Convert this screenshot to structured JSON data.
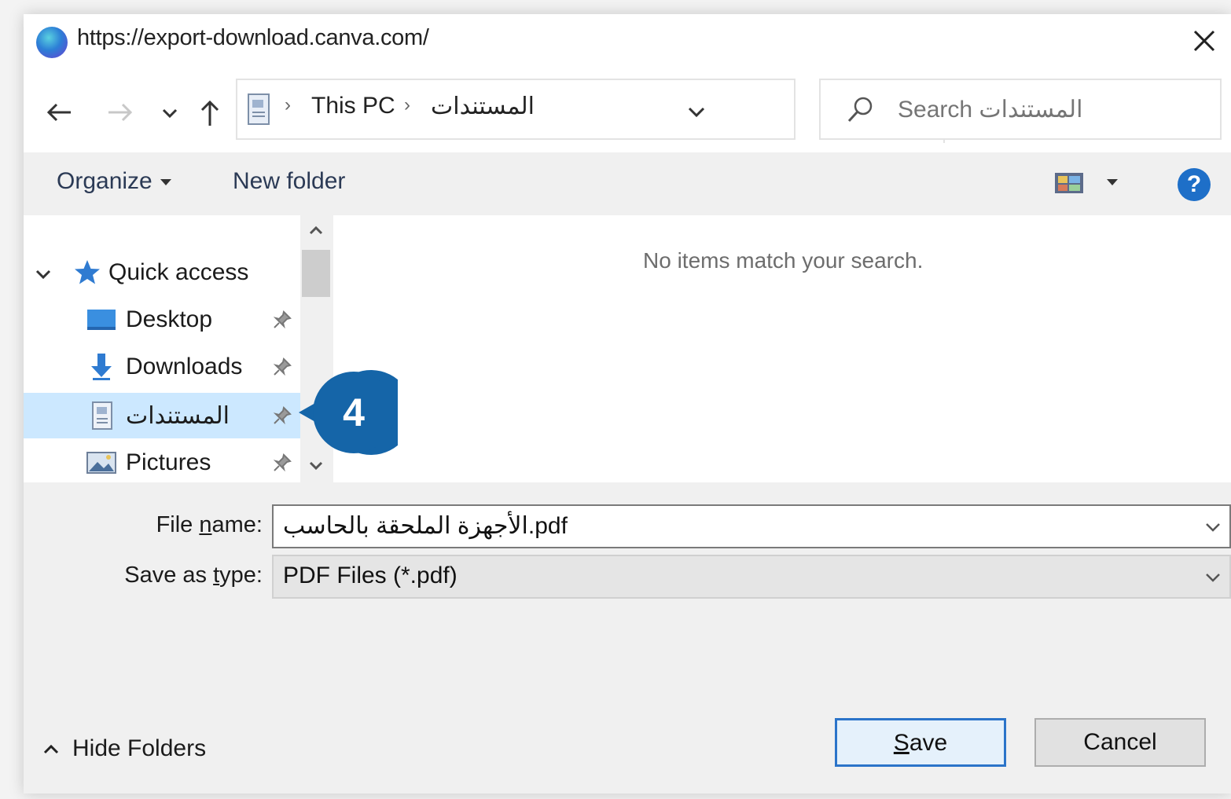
{
  "window": {
    "title": "https://export-download.canva.com/"
  },
  "nav": {
    "breadcrumb_root": "This PC",
    "breadcrumb_folder": "المستندات",
    "search_placeholder": "Search المستندات"
  },
  "toolbar": {
    "organize_label": "Organize",
    "new_folder_label": "New folder"
  },
  "sidebar": {
    "items": [
      {
        "label": "Quick access",
        "icon": "star-icon"
      },
      {
        "label": "Desktop",
        "icon": "desktop-icon"
      },
      {
        "label": "Downloads",
        "icon": "download-icon"
      },
      {
        "label": "المستندات",
        "icon": "document-icon",
        "selected": true
      },
      {
        "label": "Pictures",
        "icon": "pictures-icon"
      }
    ]
  },
  "content": {
    "empty_message": "No items match your search."
  },
  "callout": {
    "number": "4",
    "color": "#1565a8"
  },
  "form": {
    "file_name_label_pre": "File ",
    "file_name_label_u": "n",
    "file_name_label_post": "ame:",
    "file_name_value": "الأجهزة الملحقة بالحاسب.pdf",
    "save_type_label_pre": "Save as ",
    "save_type_label_u": "t",
    "save_type_label_post": "ype:",
    "save_type_value": "PDF Files (*.pdf)"
  },
  "footer": {
    "hide_folders_label": "Hide Folders",
    "save_u": "S",
    "save_rest": "ave",
    "cancel_label": "Cancel"
  },
  "colors": {
    "accent": "#2b74c9",
    "selection": "#cce8ff",
    "help": "#1e6fc8"
  }
}
